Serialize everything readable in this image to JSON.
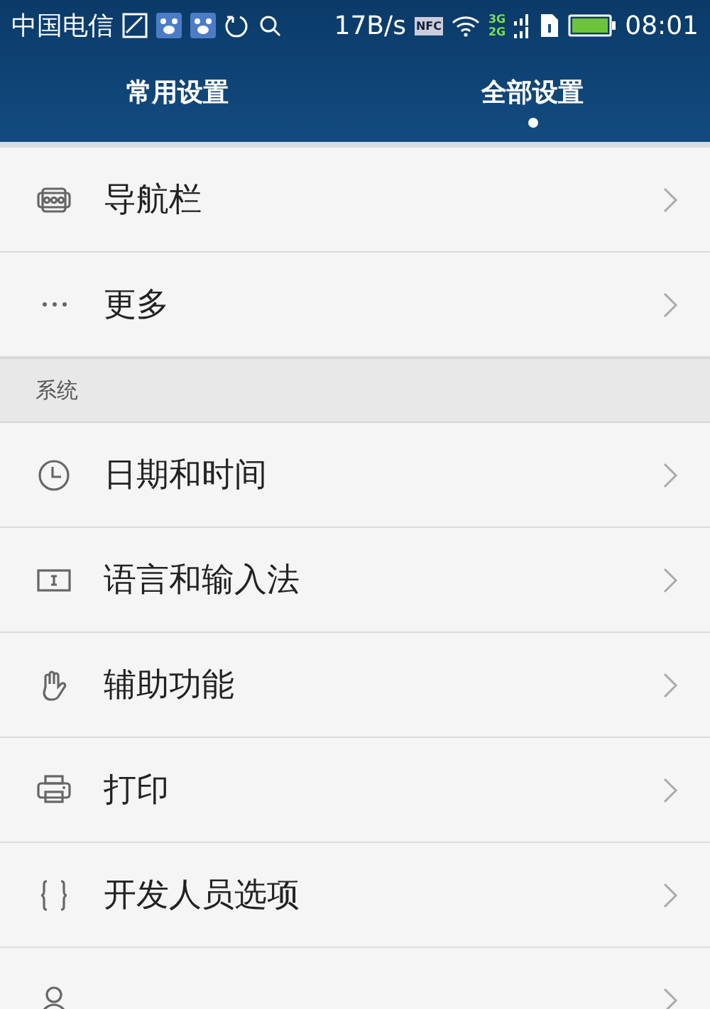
{
  "status_bar": {
    "carrier": "中国电信",
    "speed": "17B/s",
    "nfc": "NFC",
    "network_top": "3G",
    "network_bottom": "2G",
    "time": "08:01"
  },
  "tabs": [
    {
      "label": "常用设置",
      "selected": false
    },
    {
      "label": "全部设置",
      "selected": true
    }
  ],
  "sections": [
    {
      "items": [
        {
          "kind": "navbar",
          "label": "导航栏"
        },
        {
          "kind": "more",
          "label": "更多"
        }
      ]
    },
    {
      "header": "系统",
      "items": [
        {
          "kind": "clock",
          "label": "日期和时间"
        },
        {
          "kind": "keyboard",
          "label": "语言和输入法"
        },
        {
          "kind": "hand",
          "label": "辅助功能"
        },
        {
          "kind": "printer",
          "label": "打印"
        },
        {
          "kind": "braces",
          "label": "开发人员选项"
        },
        {
          "kind": "person"
        }
      ]
    }
  ]
}
